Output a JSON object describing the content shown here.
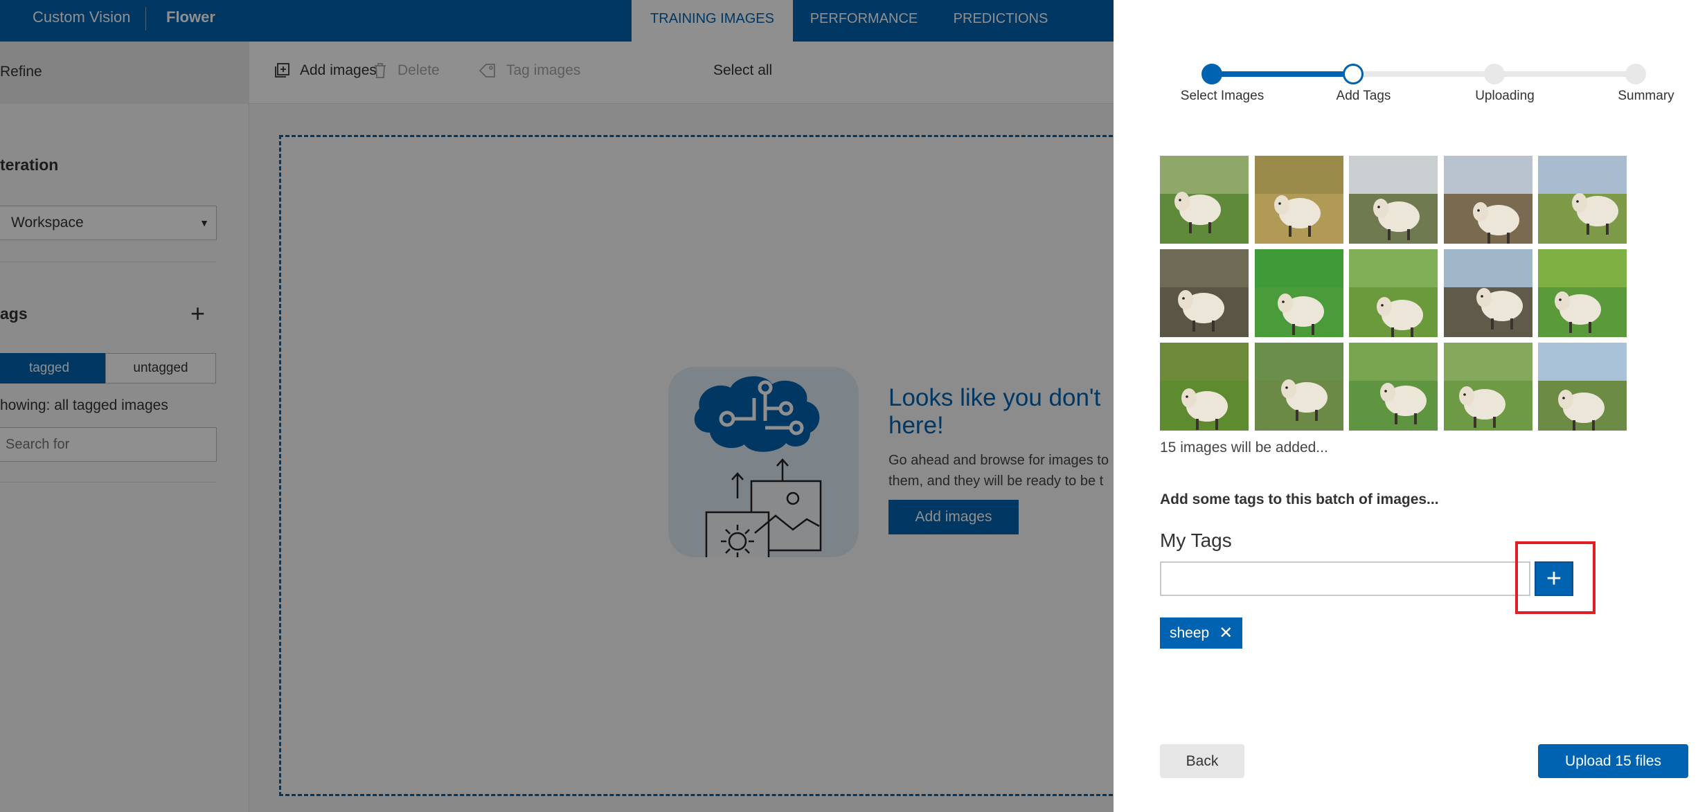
{
  "app": {
    "brand": "Custom Vision",
    "project": "Flower",
    "tabs": [
      "TRAINING IMAGES",
      "PERFORMANCE",
      "PREDICTIONS"
    ],
    "active_tab": "TRAINING IMAGES"
  },
  "sidebar": {
    "refine": "Refine",
    "iteration_title": "teration",
    "iteration_select": "Workspace",
    "tags_title": "ags",
    "filter_tagged": "tagged",
    "filter_untagged": "untagged",
    "showing": "howing: all tagged images",
    "search_placeholder": "Search for"
  },
  "toolbar": {
    "add_images": "Add images",
    "delete": "Delete",
    "tag_images": "Tag images",
    "select_all": "Select all"
  },
  "empty_state": {
    "title_line1": "Looks like you don't",
    "title_line2": "here!",
    "desc_line1": "Go ahead and browse for images to",
    "desc_line2": "them, and they will be ready to be t",
    "button": "Add images"
  },
  "panel": {
    "close": "×",
    "steps": [
      "Select Images",
      "Add Tags",
      "Uploading",
      "Summary"
    ],
    "current_step": 1,
    "image_count_text": "15 images will be added...",
    "hint": "Add some tags to this batch of images...",
    "my_tags_title": "My Tags",
    "tag_input_value": "",
    "add_tag_icon": "plus-icon",
    "tags": [
      "sheep"
    ],
    "back_label": "Back",
    "upload_label": "Upload 15 files"
  },
  "colors": {
    "brand_blue": "#0063b1",
    "highlight_red": "#e02020"
  }
}
